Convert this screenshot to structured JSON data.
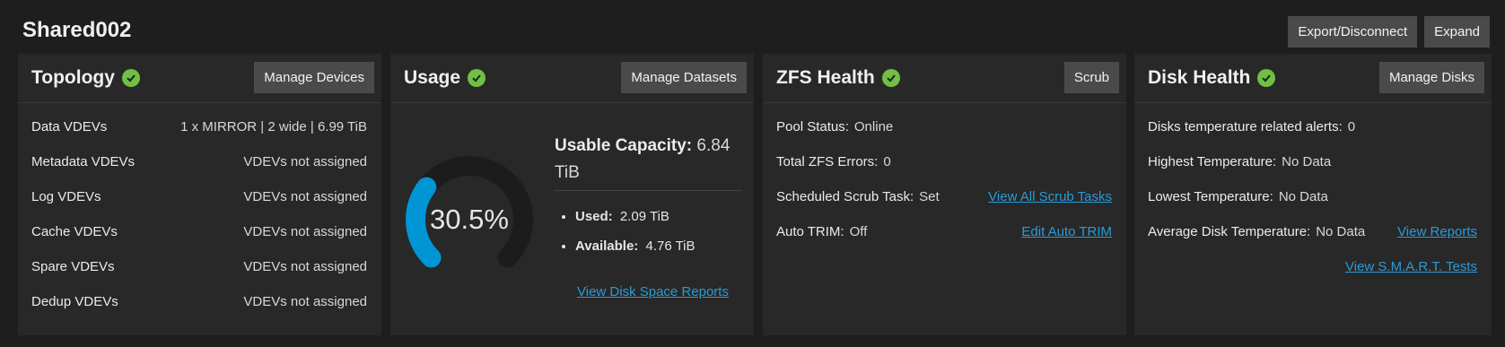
{
  "pool": {
    "name": "Shared002",
    "export_label": "Export/Disconnect",
    "expand_label": "Expand"
  },
  "colors": {
    "accent": "#0095d5",
    "ok": "#71bf44",
    "link": "#2a9ad8"
  },
  "topology": {
    "title": "Topology",
    "button": "Manage Devices",
    "rows": [
      {
        "label": "Data VDEVs",
        "value": "1 x MIRROR | 2 wide | 6.99 TiB"
      },
      {
        "label": "Metadata VDEVs",
        "value": "VDEVs not assigned"
      },
      {
        "label": "Log VDEVs",
        "value": "VDEVs not assigned"
      },
      {
        "label": "Cache VDEVs",
        "value": "VDEVs not assigned"
      },
      {
        "label": "Spare VDEVs",
        "value": "VDEVs not assigned"
      },
      {
        "label": "Dedup VDEVs",
        "value": "VDEVs not assigned"
      }
    ]
  },
  "usage": {
    "title": "Usage",
    "button": "Manage Datasets",
    "percent_label": "30.5%",
    "percent": 30.5,
    "capacity_label": "Usable Capacity:",
    "capacity_value": "6.84 TiB",
    "used_label": "Used:",
    "used_value": "2.09 TiB",
    "available_label": "Available:",
    "available_value": "4.76 TiB",
    "link": "View Disk Space Reports"
  },
  "zfs": {
    "title": "ZFS Health",
    "button": "Scrub",
    "pool_status_label": "Pool Status:",
    "pool_status_value": "Online",
    "errors_label": "Total ZFS Errors:",
    "errors_value": "0",
    "scrub_label": "Scheduled Scrub Task:",
    "scrub_value": "Set",
    "scrub_link": "View All Scrub Tasks",
    "trim_label": "Auto TRIM:",
    "trim_value": "Off",
    "trim_link": "Edit Auto TRIM"
  },
  "disk": {
    "title": "Disk Health",
    "button": "Manage Disks",
    "alerts_label": "Disks temperature related alerts:",
    "alerts_value": "0",
    "highest_label": "Highest Temperature:",
    "highest_value": "No Data",
    "lowest_label": "Lowest Temperature:",
    "lowest_value": "No Data",
    "avg_label": "Average Disk Temperature:",
    "avg_value": "No Data",
    "reports_link": "View Reports",
    "smart_link": "View S.M.A.R.T. Tests"
  }
}
